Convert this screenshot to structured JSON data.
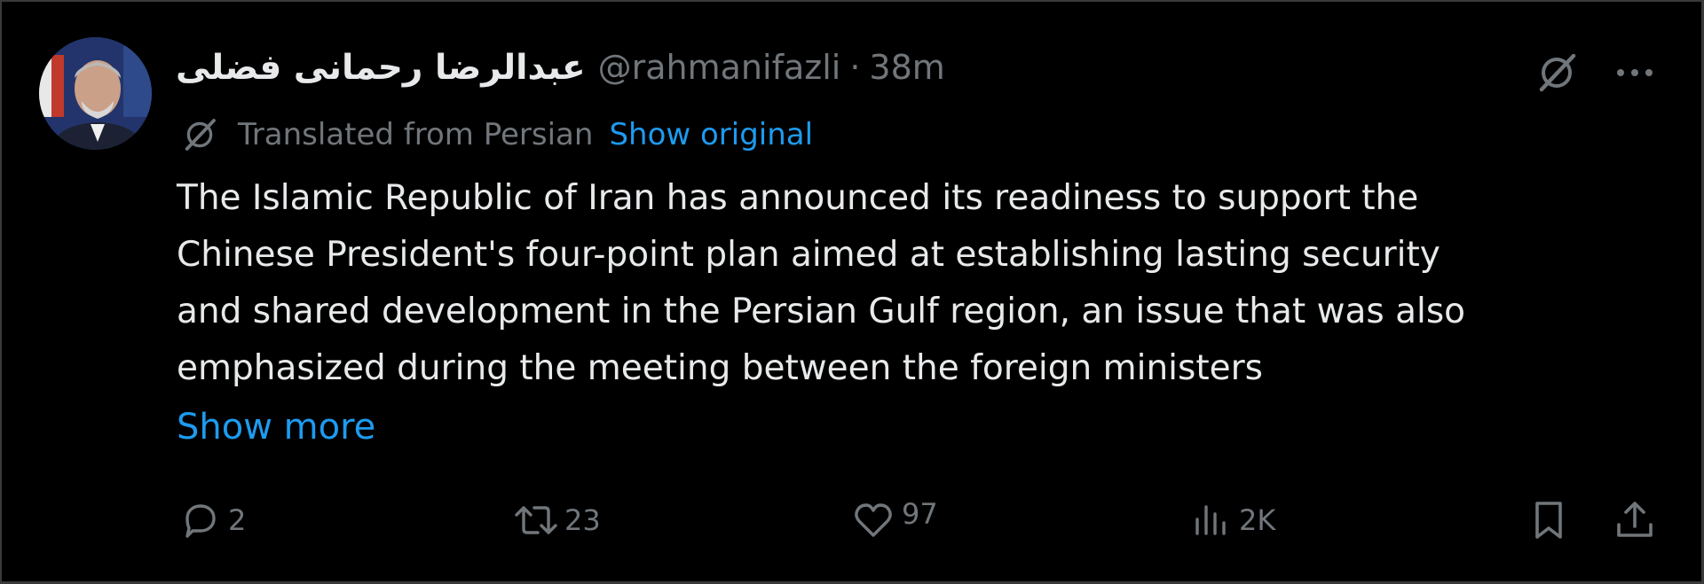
{
  "post": {
    "author": {
      "display_name": "عبدالرضا رحمانی فضلی",
      "handle": "@rahmanifazli",
      "separator": "·",
      "time": "38m"
    },
    "translation": {
      "note": "Translated from Persian",
      "show_original_label": "Show original"
    },
    "text_lines": [
      "The Islamic Republic of Iran has announced its readiness to support the",
      "Chinese President's four-point plan aimed at establishing lasting security",
      "and shared development in the Persian Gulf region, an issue that was also",
      "emphasized during the meeting between the foreign ministers"
    ],
    "show_more_label": "Show more",
    "stats": {
      "replies": "2",
      "reposts": "23",
      "likes": "97",
      "views": "2K"
    }
  },
  "icons": {
    "grok": "grok-icon",
    "more": "more-horizontal-icon",
    "translate": "grok-icon",
    "reply": "reply-icon",
    "repost": "repost-icon",
    "like": "heart-icon",
    "views": "analytics-icon",
    "bookmark": "bookmark-icon",
    "share": "share-icon"
  },
  "colors": {
    "background": "#000000",
    "text": "#e7e9ea",
    "muted": "#71767b",
    "link": "#1d9bf0"
  }
}
